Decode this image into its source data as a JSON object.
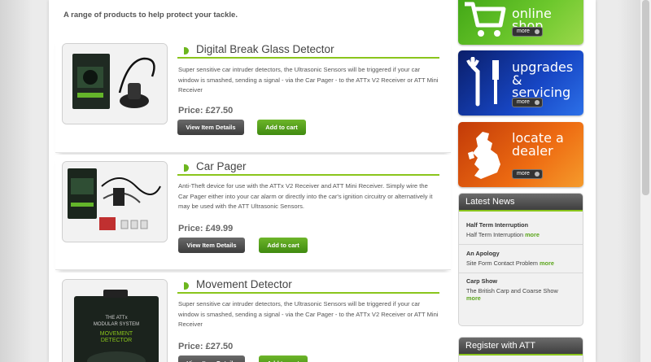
{
  "intro": "A range of products to help protect your tackle.",
  "buttons": {
    "view": "View Item Details",
    "cart": "Add to cart"
  },
  "products": [
    {
      "title": "Digital Break Glass Detector",
      "description": "Super sensitive car intruder detectors, the Ultrasonic Sensors will be triggered if your car window is smashed, sending a signal - via the Car Pager - to the ATTx V2 Receiver or ATT Mini Receiver",
      "price": "Price: £27.50"
    },
    {
      "title": "Car Pager",
      "description": "Anti-Theft device for use with the ATTx V2 Receiver and ATT Mini Receiver. Simply wire the Car Pager either into your car alarm or directly into the car's ignition circuitry or alternatively it may be used with the ATT Ultrasonic Sensors.",
      "price": "Price: £49.99"
    },
    {
      "title": "Movement Detector",
      "description": "Super sensitive car intruder detectors, the Ultrasonic Sensors will be triggered if your car window is smashed, sending a signal - via the Car Pager - to the ATTx V2 Receiver or ATT Mini Receiver",
      "price": "Price: £27.50",
      "box_text": [
        "THE ATTx",
        "MODULAR SYSTEM",
        "MOVEMENT",
        "DETECTOR"
      ]
    }
  ],
  "sidebar": {
    "promos": [
      {
        "line1": "online shop",
        "line2": "",
        "more": "more",
        "icon": "shopping-cart-icon"
      },
      {
        "line1": "upgrades",
        "line2": "& servicing",
        "more": "more",
        "icon": "screwdriver-icon"
      },
      {
        "line1": "locate a",
        "line2": "dealer",
        "more": "more",
        "icon": "uk-map-icon"
      }
    ],
    "news_title": "Latest News",
    "news": [
      {
        "title": "Half Term Interruption",
        "summary": "Half Term Interruption",
        "more": "more"
      },
      {
        "title": "An Apology",
        "summary": "Site Form Contact Problem",
        "more": "more"
      },
      {
        "title": "Carp Show",
        "summary": "The British Carp and Coarse Show",
        "more": "more"
      }
    ],
    "register_title": "Register with ATT"
  },
  "colors": {
    "accent_green": "#8ac51c",
    "dark_button": "#3c3c3c"
  }
}
